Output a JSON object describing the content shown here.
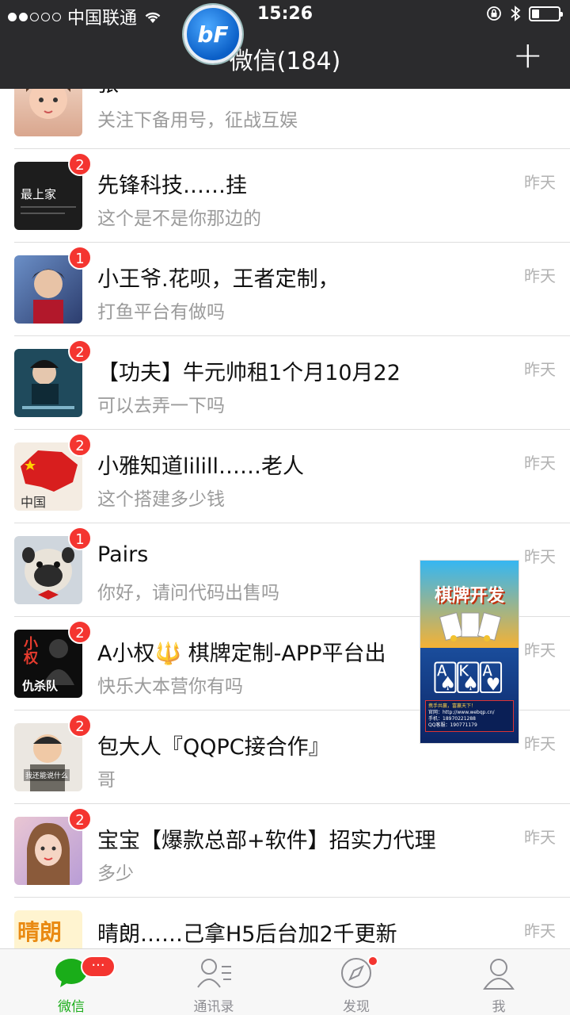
{
  "status_bar": {
    "carrier": "中国联通",
    "time": "15:26"
  },
  "header": {
    "title": "微信(184)",
    "logo_text": "bF"
  },
  "chats": [
    {
      "title": "张",
      "preview": "关注下备用号，征战互娱",
      "time": "",
      "badge": ""
    },
    {
      "title": "先锋科技……挂",
      "preview": "这个是不是你那边的",
      "time": "昨天",
      "badge": "2"
    },
    {
      "title": "小王爷.花呗，王者定制，",
      "preview": "打鱼平台有做吗",
      "time": "昨天",
      "badge": "1"
    },
    {
      "title": "【功夫】牛元帅租1个月10月22",
      "preview": "可以去弄一下吗",
      "time": "昨天",
      "badge": "2"
    },
    {
      "title": "小雅知道lilill……老人",
      "preview": "这个搭建多少钱",
      "time": "昨天",
      "badge": "2"
    },
    {
      "title": "Pairs",
      "preview": "你好，请问代码出售吗",
      "time": "昨天",
      "badge": "1"
    },
    {
      "title": "A小权🔱 棋牌定制-APP平台出",
      "preview": "快乐大本营你有吗",
      "time": "昨天",
      "badge": "2"
    },
    {
      "title": "包大人『QQPC接合作』",
      "preview": "哥",
      "time": "昨天",
      "badge": "2"
    },
    {
      "title": "宝宝【爆款总部+软件】招实力代理",
      "preview": "多少",
      "time": "昨天",
      "badge": "2"
    },
    {
      "title": "晴朗……己拿H5后台加2千更新",
      "preview": "",
      "time": "昨天",
      "badge": ""
    }
  ],
  "avatars": {
    "row1_text": "最上家",
    "row4_text": "中国",
    "row6_text": "小权",
    "row6_text2": "仇杀队",
    "row7_text": "我还能说什么",
    "row9_text": "晴朗"
  },
  "ad_overlay": {
    "title": "棋牌开发",
    "line1": "携手共赢，富赢天下！",
    "line2": "官网：http://www.webqp.cn/",
    "line3": "手机：18970221288",
    "line4": "QQ客服：190771179"
  },
  "tabbar": {
    "tabs": [
      {
        "label": "微信"
      },
      {
        "label": "通讯录"
      },
      {
        "label": "发现"
      },
      {
        "label": "我"
      }
    ],
    "chat_badge": "···"
  },
  "colors": {
    "accent_green": "#1aad19",
    "badge_red": "#f43530",
    "nav_dark": "#2b2b2d"
  }
}
